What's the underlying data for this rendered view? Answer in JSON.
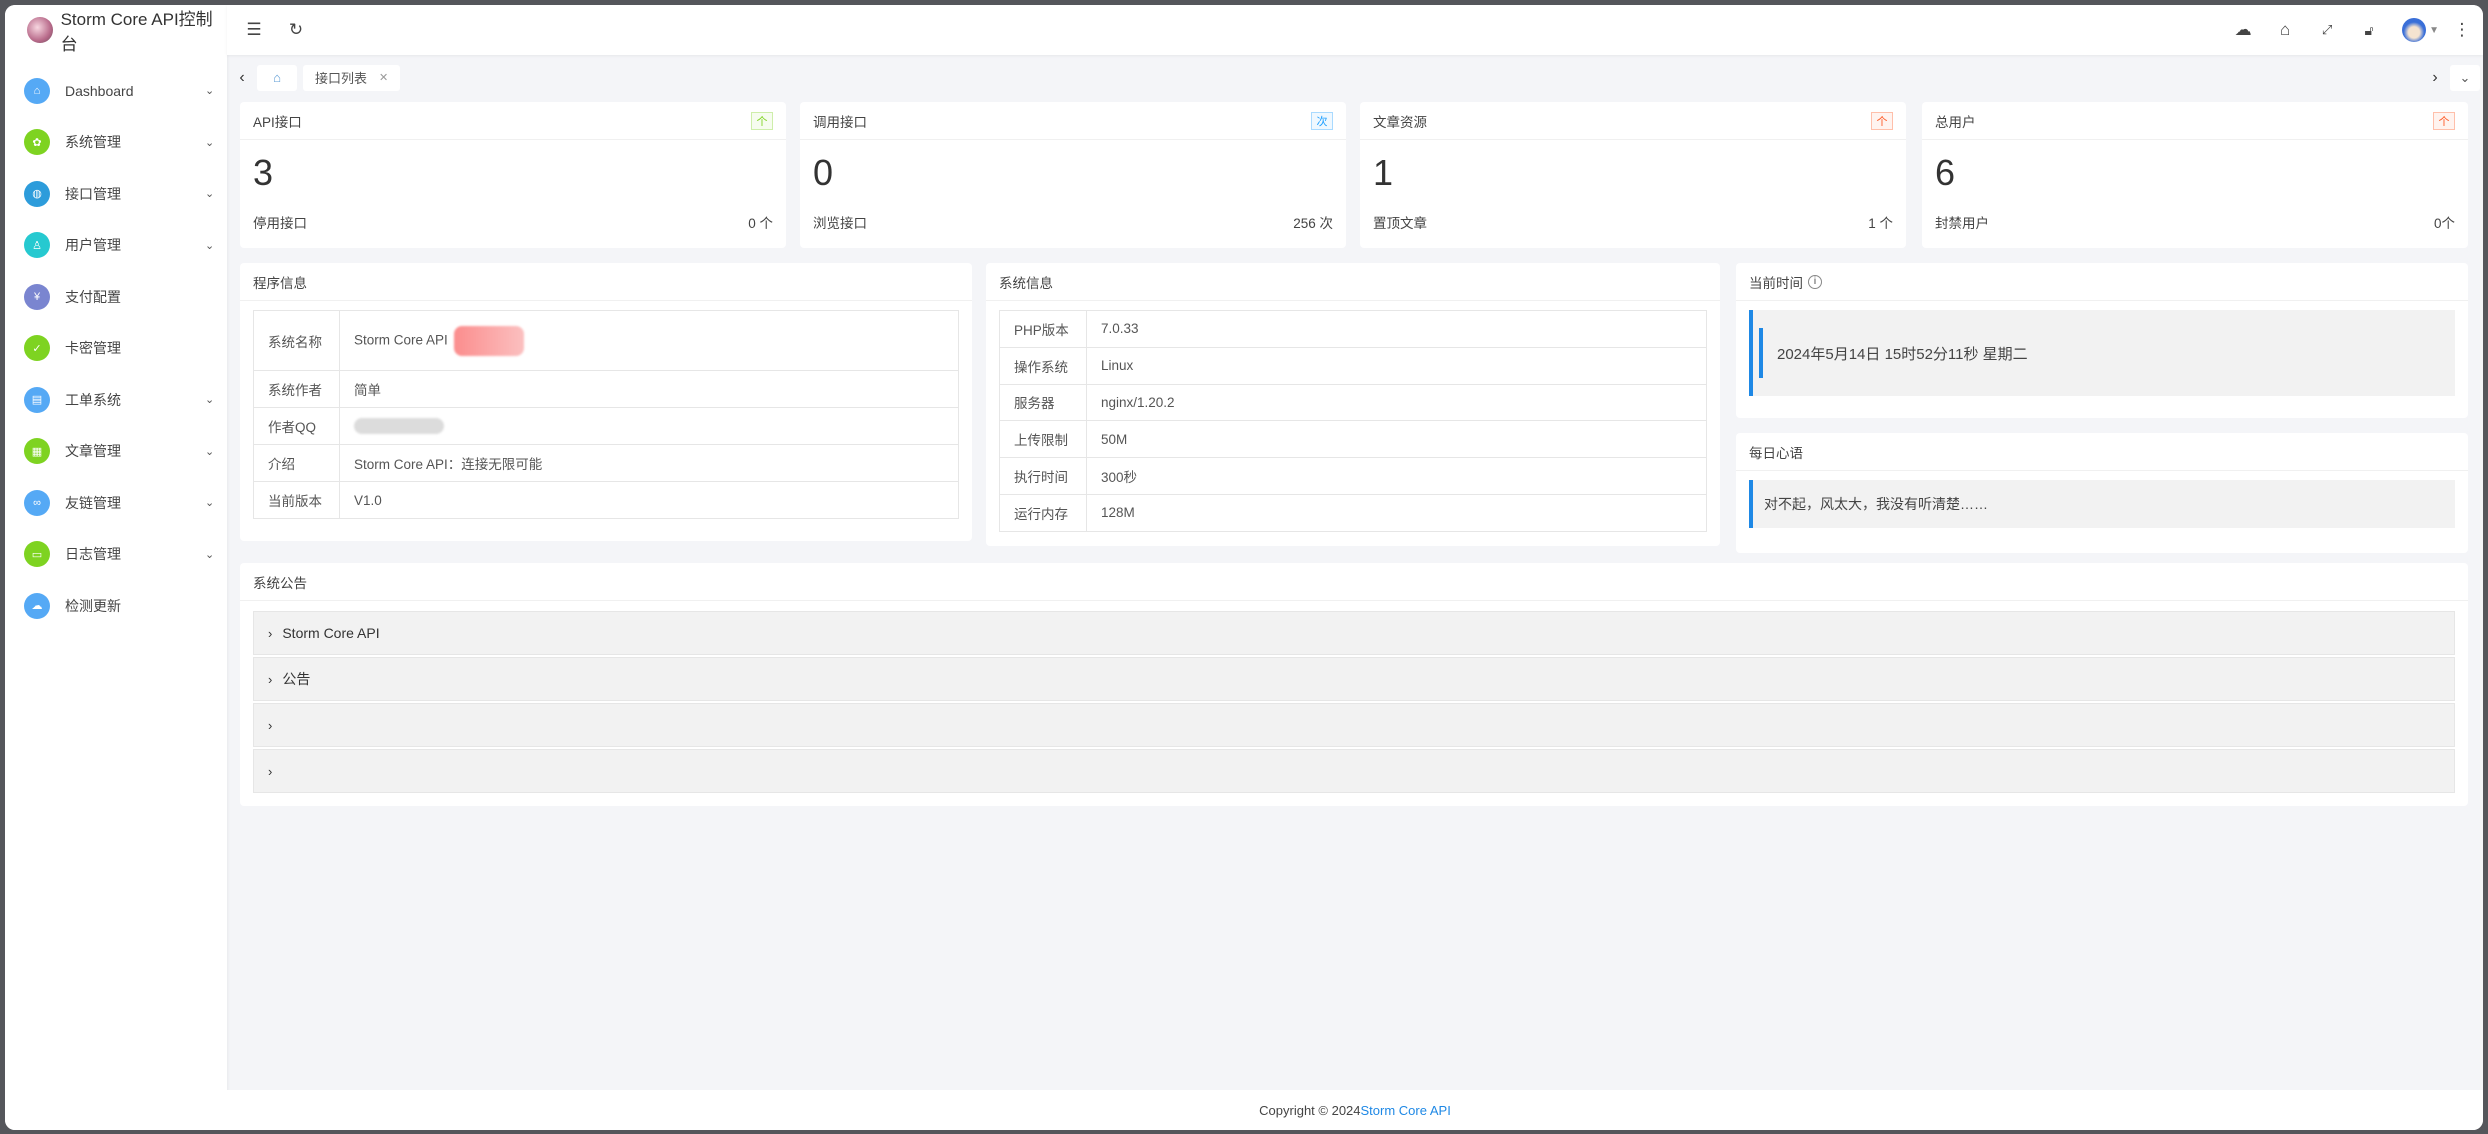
{
  "app": {
    "title": "Storm Core API控制台"
  },
  "sidebar": {
    "items": [
      {
        "label": "Dashboard",
        "icon": "home-icon",
        "color": "#55a9f5",
        "expandable": true
      },
      {
        "label": "系统管理",
        "icon": "gear-icon",
        "color": "#7ed321",
        "expandable": true
      },
      {
        "label": "接口管理",
        "icon": "globe-icon",
        "color": "#2d9cdb",
        "expandable": true
      },
      {
        "label": "用户管理",
        "icon": "user-icon",
        "color": "#26c9d0",
        "expandable": true
      },
      {
        "label": "支付配置",
        "icon": "yen-icon",
        "color": "#7a85d0",
        "expandable": false
      },
      {
        "label": "卡密管理",
        "icon": "shield-check-icon",
        "color": "#7ed321",
        "expandable": false
      },
      {
        "label": "工单系统",
        "icon": "clipboard-icon",
        "color": "#55a9f5",
        "expandable": true
      },
      {
        "label": "文章管理",
        "icon": "table-icon",
        "color": "#7ed321",
        "expandable": true
      },
      {
        "label": "友链管理",
        "icon": "link-icon",
        "color": "#55a9f5",
        "expandable": true
      },
      {
        "label": "日志管理",
        "icon": "file-icon",
        "color": "#7ed321",
        "expandable": true
      },
      {
        "label": "检测更新",
        "icon": "cloud-upload-icon",
        "color": "#55a9f5",
        "expandable": false
      }
    ]
  },
  "tabs": {
    "items": [
      {
        "label": "接口列表"
      }
    ]
  },
  "stats": [
    {
      "title": "API接口",
      "badge": "个",
      "badge_color": "#7ed321",
      "value": "3",
      "sub_label": "停用接口",
      "sub_value": "0 个"
    },
    {
      "title": "调用接口",
      "badge": "次",
      "badge_color": "#1e9fff",
      "value": "0",
      "sub_label": "浏览接口",
      "sub_value": "256 次"
    },
    {
      "title": "文章资源",
      "badge": "个",
      "badge_color": "#ff5722",
      "value": "1",
      "sub_label": "置顶文章",
      "sub_value": "1 个"
    },
    {
      "title": "总用户",
      "badge": "个",
      "badge_color": "#ff5722",
      "value": "6",
      "sub_label": "封禁用户",
      "sub_value": "0个"
    }
  ],
  "program_info": {
    "title": "程序信息",
    "rows": [
      {
        "k": "系统名称",
        "v": "Storm Core API"
      },
      {
        "k": "系统作者",
        "v": "简单"
      },
      {
        "k": "作者QQ",
        "v": ""
      },
      {
        "k": "介绍",
        "v": "Storm Core API：连接无限可能"
      },
      {
        "k": "当前版本",
        "v": "V1.0"
      }
    ]
  },
  "system_info": {
    "title": "系统信息",
    "rows": [
      {
        "k": "PHP版本",
        "v": "7.0.33"
      },
      {
        "k": "操作系统",
        "v": "Linux"
      },
      {
        "k": "服务器",
        "v": "nginx/1.20.2"
      },
      {
        "k": "上传限制",
        "v": "50M"
      },
      {
        "k": "执行时间",
        "v": "300秒"
      },
      {
        "k": "运行内存",
        "v": "128M"
      }
    ]
  },
  "current_time": {
    "title": "当前时间",
    "value": "2024年5月14日 15时52分11秒 星期二"
  },
  "daily_quote": {
    "title": "每日心语",
    "value": "对不起，风太大，我没有听清楚……"
  },
  "notices": {
    "title": "系统公告",
    "items": [
      "Storm Core API",
      "公告",
      "",
      ""
    ]
  },
  "footer": {
    "copyright": "Copyright © 2024",
    "link": "Storm Core API",
    "link_color": "#1e88e5"
  }
}
